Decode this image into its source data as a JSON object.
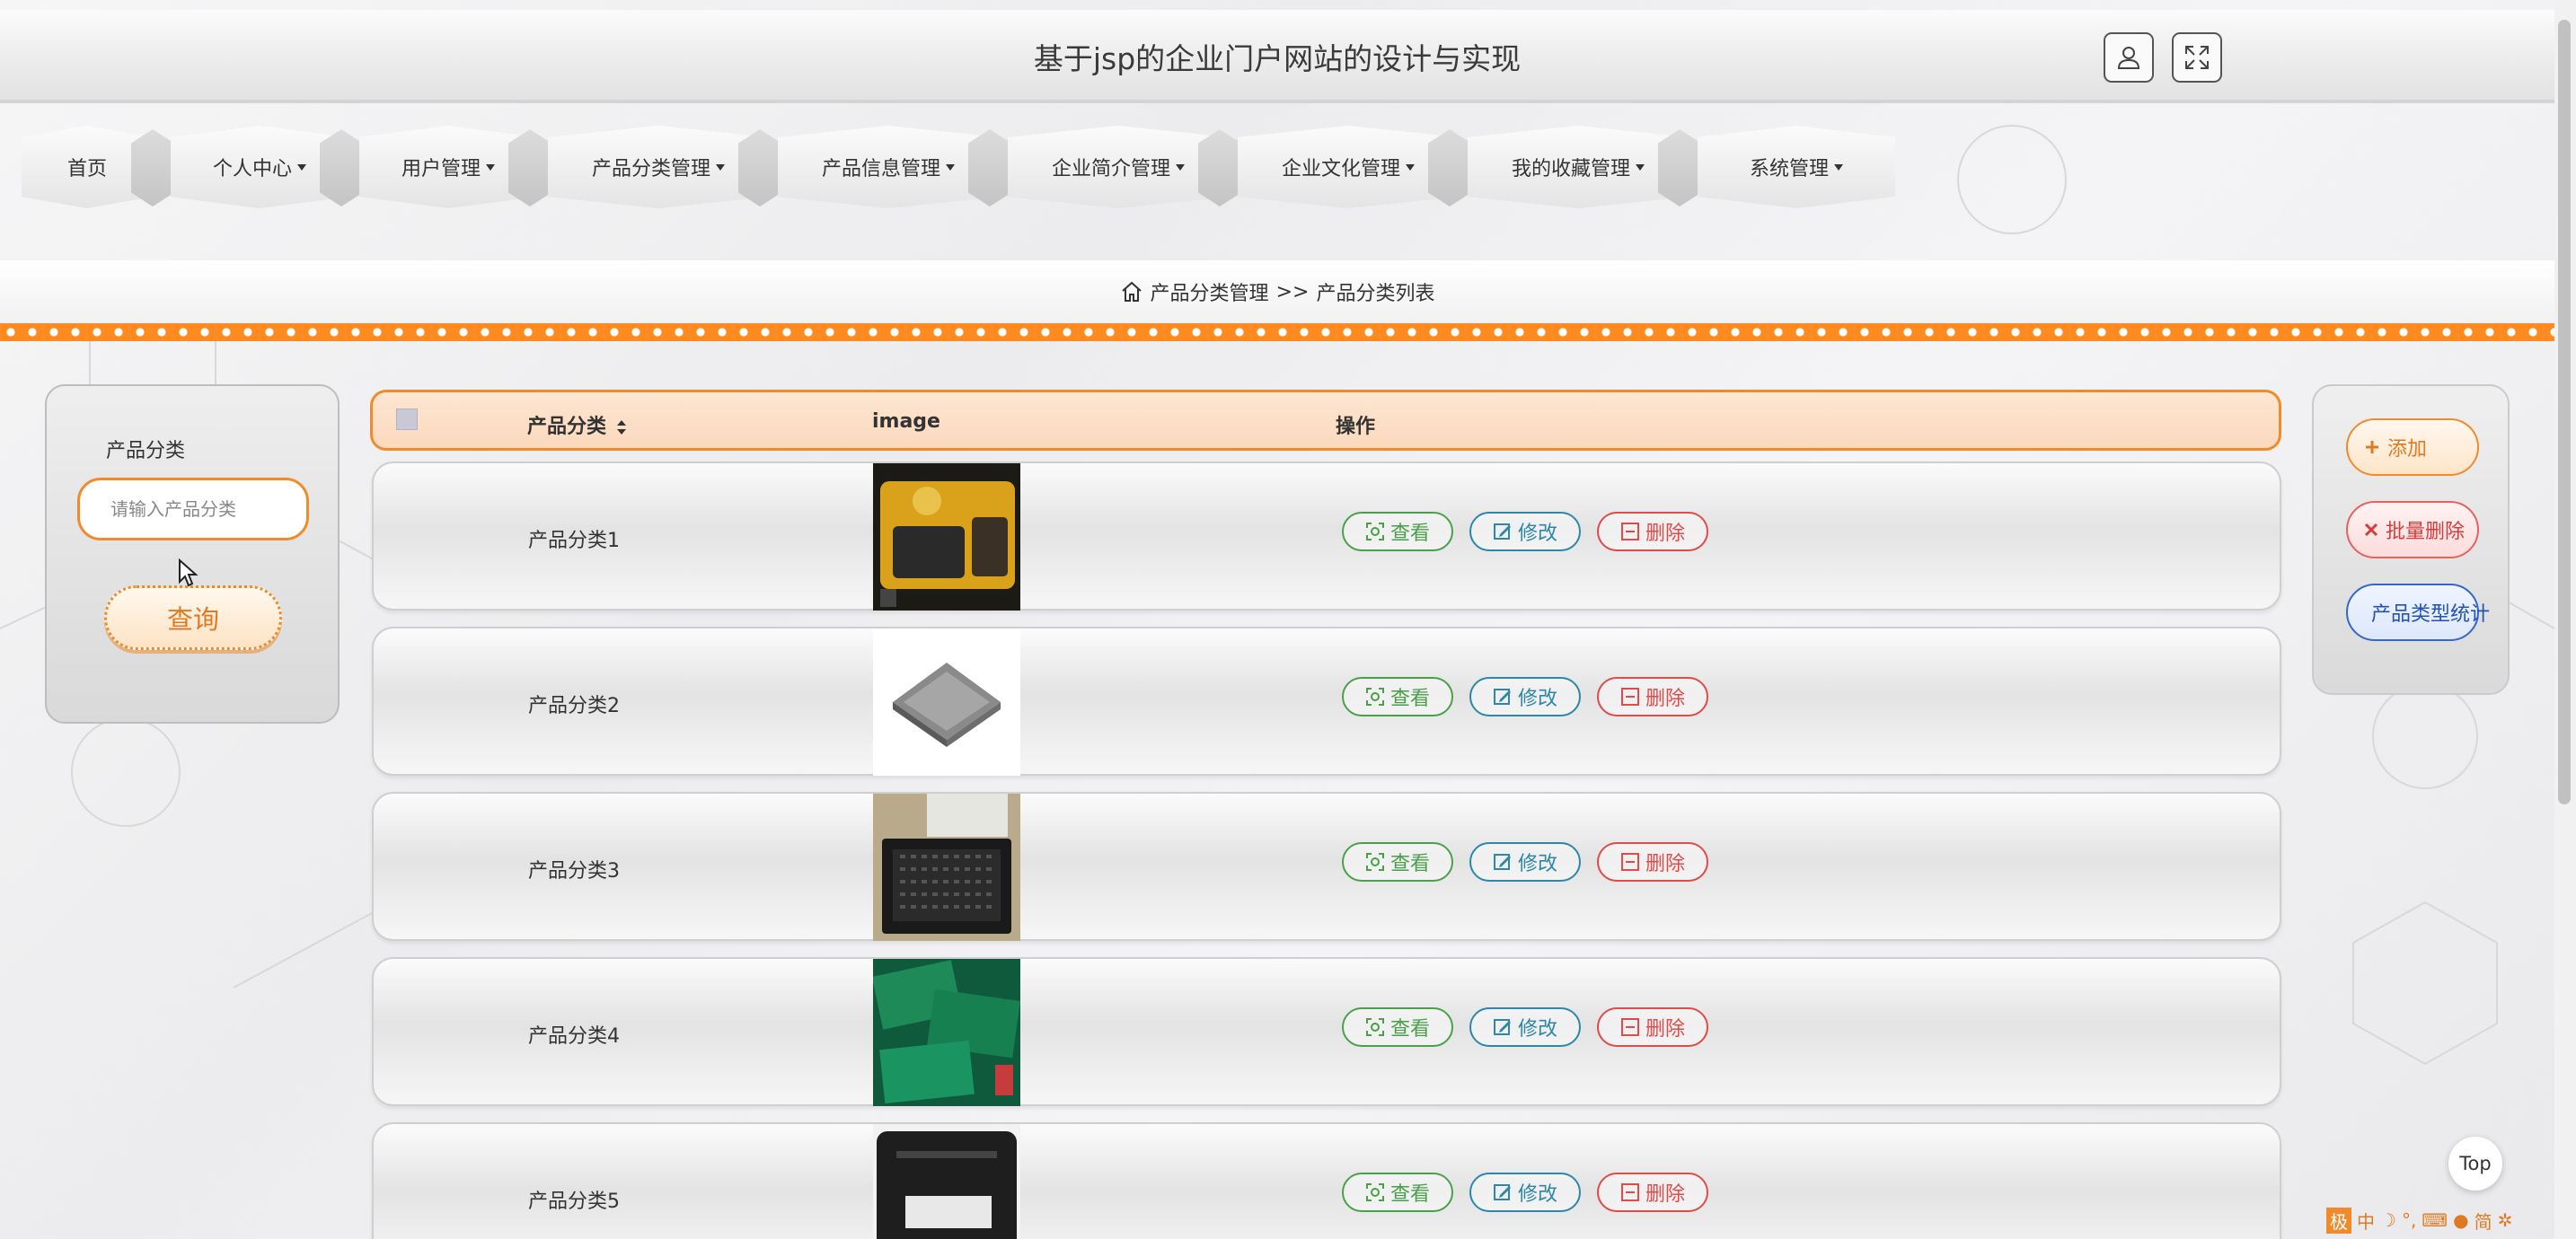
{
  "app": {
    "title": "基于jsp的企业门户网站的设计与实现"
  },
  "header": {
    "user_icon": "user-icon",
    "fullscreen_icon": "fullscreen-icon"
  },
  "nav": [
    {
      "label": "首页",
      "dropdown": false
    },
    {
      "label": "个人中心",
      "dropdown": true
    },
    {
      "label": "用户管理",
      "dropdown": true
    },
    {
      "label": "产品分类管理",
      "dropdown": true
    },
    {
      "label": "产品信息管理",
      "dropdown": true
    },
    {
      "label": "企业简介管理",
      "dropdown": true
    },
    {
      "label": "企业文化管理",
      "dropdown": true
    },
    {
      "label": "我的收藏管理",
      "dropdown": true
    },
    {
      "label": "系统管理",
      "dropdown": true
    }
  ],
  "breadcrumb": {
    "home_icon": "home-icon",
    "section": "产品分类管理",
    "separator": ">>",
    "page": "产品分类列表"
  },
  "search": {
    "label": "产品分类",
    "placeholder": "请输入产品分类",
    "value": "",
    "button": "查询"
  },
  "table": {
    "columns": [
      "产品分类",
      "image",
      "操作"
    ],
    "rows": [
      {
        "name": "产品分类1",
        "image": "product-photo-yellow-device"
      },
      {
        "name": "产品分类2",
        "image": "product-photo-chip-module"
      },
      {
        "name": "产品分类3",
        "image": "product-photo-keypad-board"
      },
      {
        "name": "产品分类4",
        "image": "product-photo-green-circuit-boards"
      },
      {
        "name": "产品分类5",
        "image": "product-photo-black-device"
      }
    ],
    "actions": {
      "view": "查看",
      "edit": "修改",
      "delete": "删除"
    }
  },
  "side_actions": {
    "add": "添加",
    "batch_delete": "批量删除",
    "stats": "产品类型统计"
  },
  "top_button": "Top",
  "colors": {
    "accent": "#f08a2a",
    "view": "#4aa04a",
    "edit": "#2e86a8",
    "delete": "#e04a4a",
    "stats": "#2352b4"
  },
  "ime": [
    "极",
    "中",
    "简"
  ]
}
